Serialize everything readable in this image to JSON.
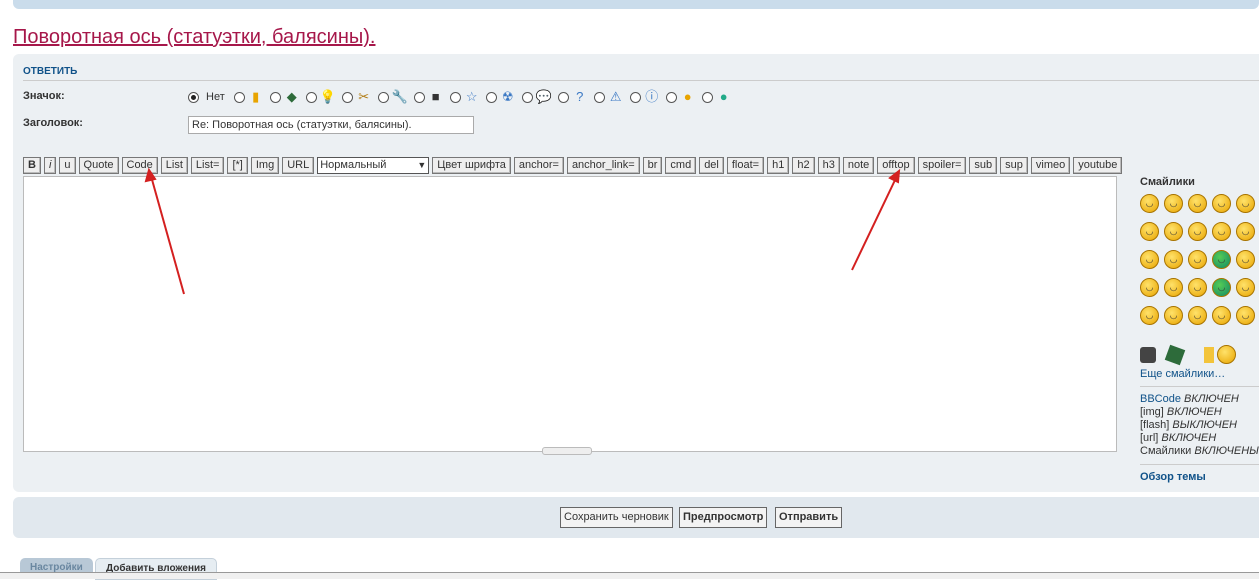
{
  "topic_title": "Поворотная ось (статуэтки, балясины).",
  "reply_header": "ОТВЕТИТЬ",
  "icon_label": "Значок:",
  "icon_none_label": "Нет",
  "icon_options": [
    "beer-icon",
    "circuit-board-icon",
    "lightbulb-icon",
    "pliers-icon",
    "wrench-icon",
    "motor-icon",
    "star-icon",
    "radiation-icon",
    "speech-bubble-icon",
    "question-icon",
    "warning-icon",
    "info-icon",
    "rolling-eyes-smiley-icon",
    "grin-green-smiley-icon"
  ],
  "subject_label": "Заголовок:",
  "subject_value": "Re: Поворотная ось (статуэтки, балясины).",
  "toolbar": {
    "before": [
      "B",
      "i",
      "u",
      "Quote",
      "Code",
      "List",
      "List=",
      "[*]",
      "Img",
      "URL"
    ],
    "font_size": "Нормальный",
    "after": [
      "Цвет шрифта",
      "anchor=",
      "anchor_link=",
      "br",
      "cmd",
      "del",
      "float=",
      "h1",
      "h2",
      "h3",
      "note",
      "offtop",
      "spoiler=",
      "sub",
      "sup",
      "vimeo",
      "youtube"
    ]
  },
  "sidebar": {
    "smilies_title": "Смайлики",
    "more_smilies": "Еще смайлики…",
    "status": [
      {
        "name": "BBCode",
        "state": "ВКЛЮЧЕН"
      },
      {
        "name": "[img]",
        "state": "ВКЛЮЧЕН"
      },
      {
        "name": "[flash]",
        "state": "ВЫКЛЮЧЕН"
      },
      {
        "name": "[url]",
        "state": "ВКЛЮЧЕН"
      },
      {
        "name": "Смайлики",
        "state": "ВКЛЮЧЕНЫ"
      }
    ],
    "topic_review": "Обзор темы"
  },
  "buttons": {
    "save_draft": "Сохранить черновик",
    "preview": "Предпросмотр",
    "submit": "Отправить"
  },
  "tabs": [
    "Настройки",
    "Добавить вложения"
  ],
  "colors": {
    "title": "#a6174a",
    "link": "#105289",
    "panel": "#ecf0f3",
    "annotation_arrow": "#d42020"
  }
}
